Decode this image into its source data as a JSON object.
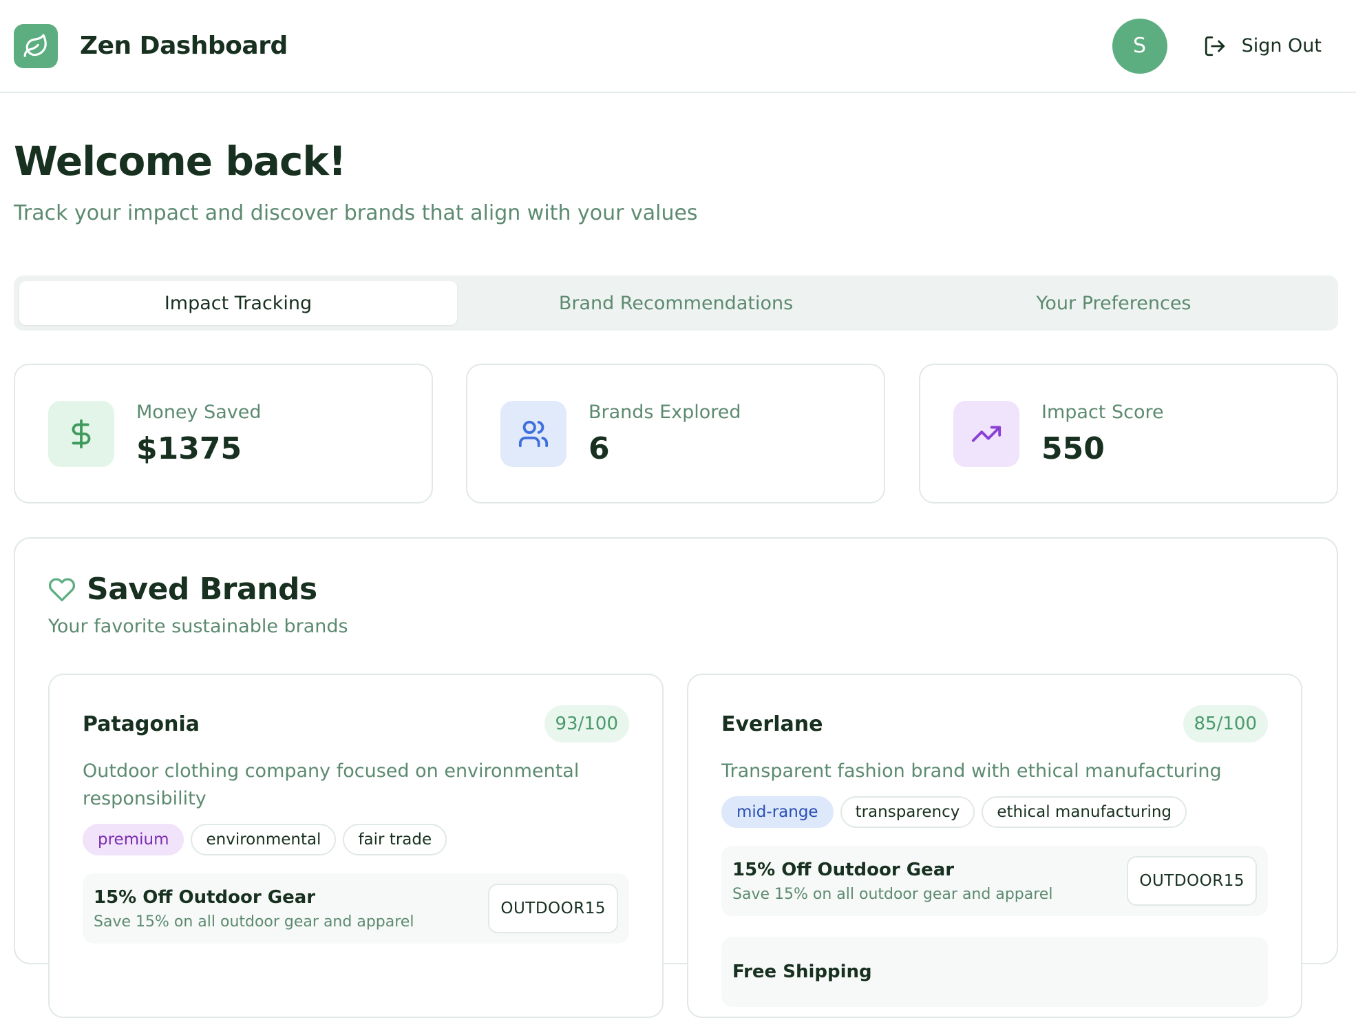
{
  "app": {
    "title": "Zen Dashboard",
    "logo_icon": "leaf-icon"
  },
  "user": {
    "avatar_initial": "S",
    "signout_label": "Sign Out"
  },
  "welcome": {
    "title": "Welcome back!",
    "subtitle": "Track your impact and discover brands that align with your values"
  },
  "tabs": [
    {
      "label": "Impact Tracking",
      "active": true
    },
    {
      "label": "Brand Recommendations",
      "active": false
    },
    {
      "label": "Your Preferences",
      "active": false
    }
  ],
  "stats": [
    {
      "label": "Money Saved",
      "value": "$1375",
      "icon": "dollar-icon",
      "color": "#3f9a5e",
      "bg": "#e2f5e8"
    },
    {
      "label": "Brands Explored",
      "value": "6",
      "icon": "users-icon",
      "color": "#3f6fdc",
      "bg": "#e1eafb"
    },
    {
      "label": "Impact Score",
      "value": "550",
      "icon": "trending-up-icon",
      "color": "#8a3fd6",
      "bg": "#efe4fb"
    }
  ],
  "saved_brands": {
    "title": "Saved Brands",
    "subtitle": "Your favorite sustainable brands",
    "brands": [
      {
        "name": "Patagonia",
        "score": "93/100",
        "description": "Outdoor clothing company focused on environmental responsibility",
        "tags": [
          "premium",
          "environmental",
          "fair trade"
        ],
        "deal": {
          "title": "15% Off Outdoor Gear",
          "subtitle": "Save 15% on all outdoor gear and apparel",
          "code": "OUTDOOR15"
        }
      },
      {
        "name": "Everlane",
        "score": "85/100",
        "description": "Transparent fashion brand with ethical manufacturing",
        "tags": [
          "mid-range",
          "transparency",
          "ethical manufacturing"
        ],
        "deal": {
          "title": "15% Off Outdoor Gear",
          "subtitle": "Save 15% on all outdoor gear and apparel",
          "code": "OUTDOOR15"
        },
        "deal2": {
          "title": "Free Shipping"
        }
      }
    ]
  }
}
